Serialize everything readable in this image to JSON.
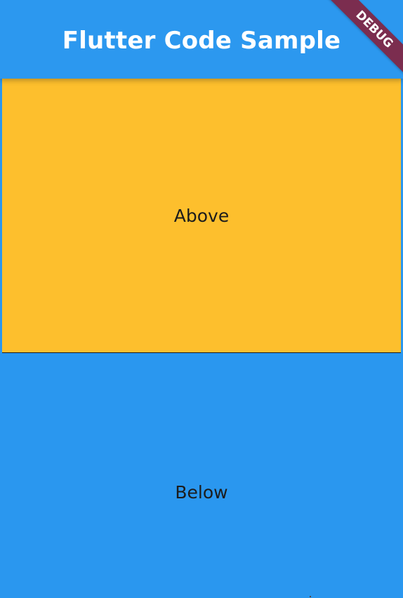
{
  "appbar": {
    "title": "Flutter Code Sample"
  },
  "debug_banner": {
    "label": "DEBUG"
  },
  "sections": {
    "above": {
      "label": "Above",
      "color": "#fdbf2d"
    },
    "below": {
      "label": "Below",
      "color": "#2a97ef"
    }
  },
  "colors": {
    "appbar": "#2c98ef",
    "banner": "#7b2d4f"
  }
}
